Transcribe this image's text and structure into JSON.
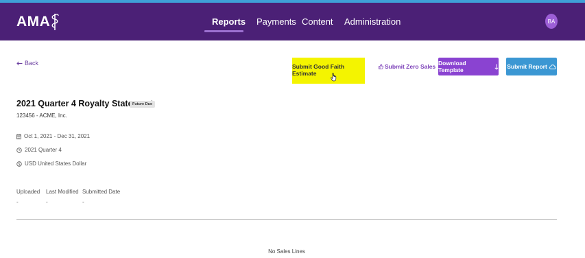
{
  "brand": {
    "logo_text": "AMA"
  },
  "nav": {
    "items": [
      {
        "label": "Reports"
      },
      {
        "label": "Payments"
      },
      {
        "label": "Content"
      },
      {
        "label": "Administration"
      }
    ],
    "active": "Reports"
  },
  "user": {
    "initials": "BA"
  },
  "toolbar": {
    "back_label": "Back",
    "good_faith_label": "Submit Good Faith Estimate",
    "zero_sales_label": "Submit Zero Sales",
    "download_label": "Download Template",
    "submit_label": "Submit Report"
  },
  "statement": {
    "title": "2021 Quarter 4 Royalty Statement",
    "status": "Future Due",
    "licensee": "123456 - ACME, Inc.",
    "date_range": "Oct 1, 2021 - Dec 31, 2021",
    "period": "2021 Quarter 4",
    "currency": "USD United States Dollar"
  },
  "columns": [
    {
      "header": "Uploaded",
      "value": "-"
    },
    {
      "header": "Last Modified",
      "value": "-"
    },
    {
      "header": "Submitted Date",
      "value": "-"
    }
  ],
  "sales_lines": {
    "empty_text": "No Sales Lines"
  },
  "colors": {
    "nav_bg": "#4b2076",
    "highlight": "#f4f400",
    "download_bg": "#8a43d1",
    "submit_bg": "#3b97d3",
    "link": "#6b3fa0"
  },
  "icons": [
    "caduceus-icon",
    "arrow-left-icon",
    "thumbs-up-icon",
    "arrow-down-icon",
    "cloud-upload-icon",
    "calendar-icon",
    "clock-icon",
    "currency-icon",
    "hand-cursor-icon"
  ]
}
